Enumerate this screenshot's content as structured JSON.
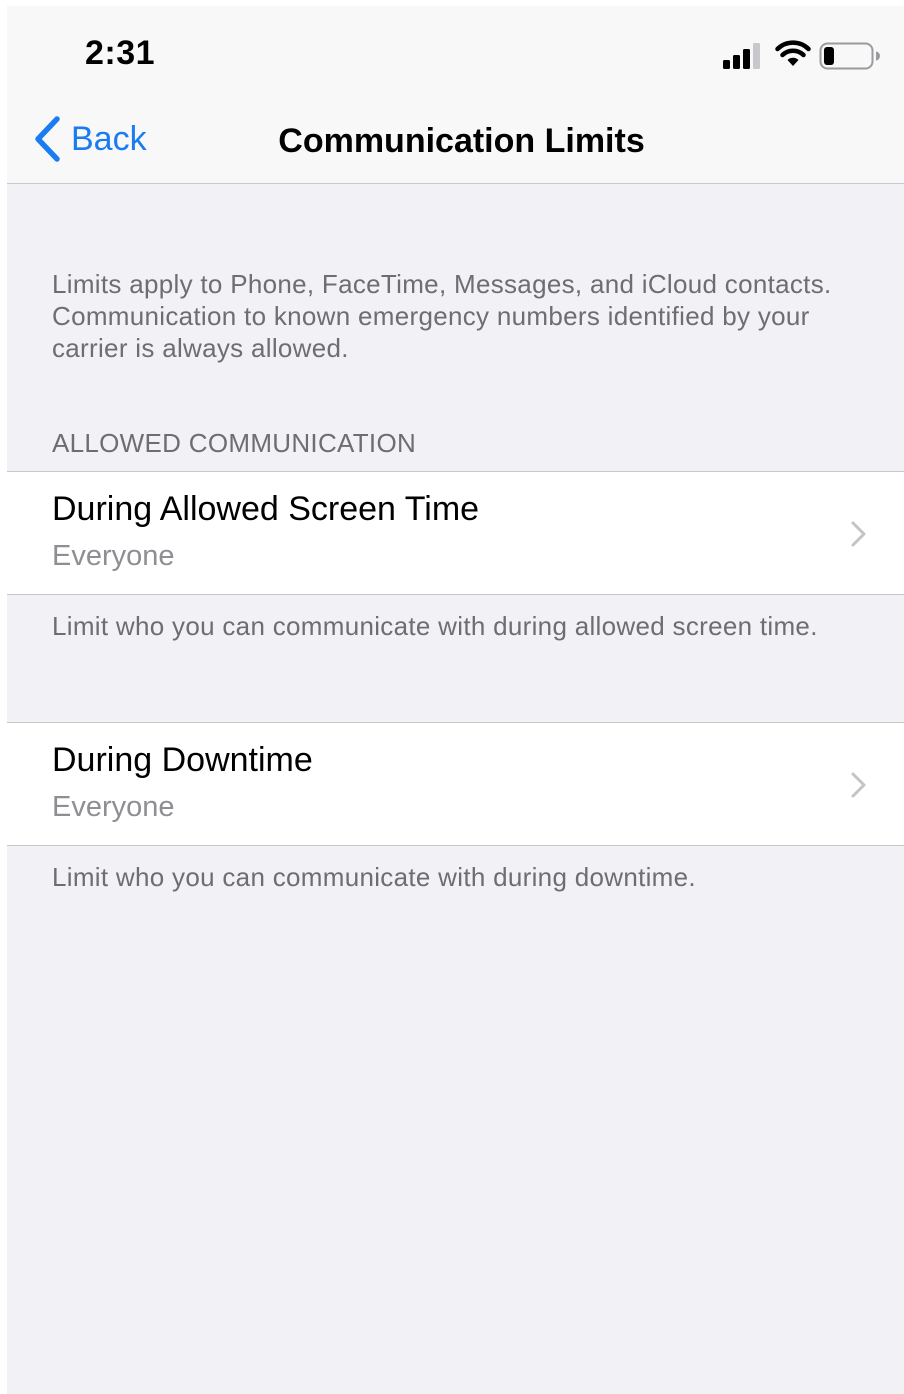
{
  "status_bar": {
    "time": "2:31",
    "signal_icon": "cellular-signal-icon",
    "wifi_icon": "wifi-icon",
    "battery_icon": "battery-low-icon"
  },
  "nav": {
    "back_label": "Back",
    "back_icon": "chevron-left-icon",
    "title": "Communication Limits"
  },
  "intro_text": "Limits apply to Phone, FaceTime, Messages, and iCloud contacts. Communication to known emergency numbers identified by your carrier is always allowed.",
  "section_header": "ALLOWED COMMUNICATION",
  "rows": [
    {
      "title": "During Allowed Screen Time",
      "subtitle": "Everyone",
      "footer": "Limit who you can communicate with during allowed screen time."
    },
    {
      "title": "During Downtime",
      "subtitle": "Everyone",
      "footer": "Limit who you can communicate with during downtime."
    }
  ],
  "colors": {
    "accent": "#1a7cf2",
    "background": "#f1f1f6",
    "secondary_text": "#6d6d72",
    "separator": "#c8c7cc"
  }
}
